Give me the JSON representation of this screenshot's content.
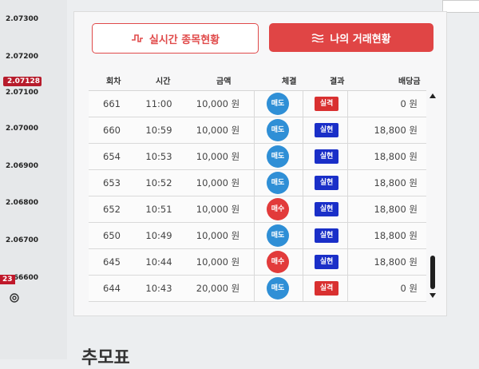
{
  "axis": {
    "ticks": [
      "2.07300",
      "2.07200",
      "2.07128",
      "2.07100",
      "2.07000",
      "2.06900",
      "2.06800",
      "2.06700",
      "66600"
    ],
    "badge": "23"
  },
  "buttons": {
    "realtime": "실시간 종목현황",
    "mytrades": "나의 거래현황"
  },
  "table": {
    "headers": [
      "회차",
      "시간",
      "금액",
      "체결",
      "결과",
      "배당금"
    ],
    "rows": [
      {
        "no": "661",
        "time": "11:00",
        "amount": "10,000 원",
        "fill": "매도",
        "result": "실격",
        "dividend": "0 원"
      },
      {
        "no": "660",
        "time": "10:59",
        "amount": "10,000 원",
        "fill": "매도",
        "result": "실현",
        "dividend": "18,800 원"
      },
      {
        "no": "654",
        "time": "10:53",
        "amount": "10,000 원",
        "fill": "매도",
        "result": "실현",
        "dividend": "18,800 원"
      },
      {
        "no": "653",
        "time": "10:52",
        "amount": "10,000 원",
        "fill": "매도",
        "result": "실현",
        "dividend": "18,800 원"
      },
      {
        "no": "652",
        "time": "10:51",
        "amount": "10,000 원",
        "fill": "매수",
        "result": "실현",
        "dividend": "18,800 원"
      },
      {
        "no": "650",
        "time": "10:49",
        "amount": "10,000 원",
        "fill": "매도",
        "result": "실현",
        "dividend": "18,800 원"
      },
      {
        "no": "645",
        "time": "10:44",
        "amount": "10,000 원",
        "fill": "매수",
        "result": "실현",
        "dividend": "18,800 원"
      },
      {
        "no": "644",
        "time": "10:43",
        "amount": "20,000 원",
        "fill": "매도",
        "result": "실격",
        "dividend": "0 원"
      }
    ]
  },
  "colors": {
    "sell": "#2f8fd6",
    "buy": "#e23b3b",
    "realized": "#1a2fc8",
    "failed": "#d93030",
    "accent": "#e04545"
  },
  "icons": {
    "realtime": "pulse-icon",
    "mytrades": "waves-icon",
    "settings": "gear-icon"
  },
  "footer_fragment": "추모표"
}
